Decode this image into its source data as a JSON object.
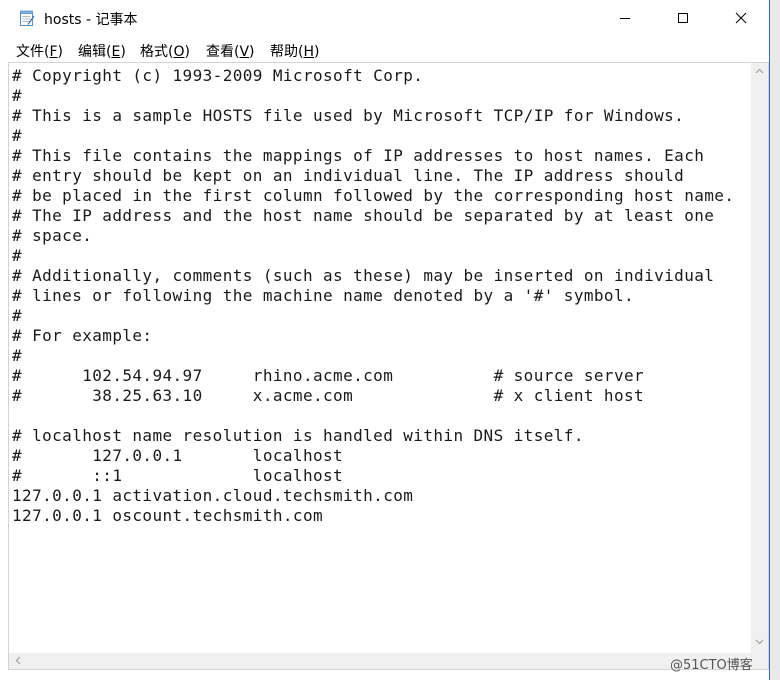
{
  "window": {
    "title": "hosts - 记事本"
  },
  "menu": [
    {
      "label": "文件(",
      "acc": "F",
      "end": ")"
    },
    {
      "label": "编辑(",
      "acc": "E",
      "end": ")"
    },
    {
      "label": "格式(",
      "acc": "O",
      "end": ")"
    },
    {
      "label": "查看(",
      "acc": "V",
      "end": ")"
    },
    {
      "label": "帮助(",
      "acc": "H",
      "end": ")"
    }
  ],
  "editor": {
    "lines": [
      "# Copyright (c) 1993-2009 Microsoft Corp.",
      "#",
      "# This is a sample HOSTS file used by Microsoft TCP/IP for Windows.",
      "#",
      "# This file contains the mappings of IP addresses to host names. Each",
      "# entry should be kept on an individual line. The IP address should",
      "# be placed in the first column followed by the corresponding host name.",
      "# The IP address and the host name should be separated by at least one",
      "# space.",
      "#",
      "# Additionally, comments (such as these) may be inserted on individual",
      "# lines or following the machine name denoted by a '#' symbol.",
      "#",
      "# For example:",
      "#",
      "#      102.54.94.97     rhino.acme.com          # source server",
      "#       38.25.63.10     x.acme.com              # x client host",
      "",
      "# localhost name resolution is handled within DNS itself.",
      "#\t127.0.0.1       localhost",
      "#\t::1             localhost",
      "127.0.0.1 activation.cloud.techsmith.com",
      "127.0.0.1 oscount.techsmith.com"
    ]
  },
  "watermark": "@51CTO博客"
}
